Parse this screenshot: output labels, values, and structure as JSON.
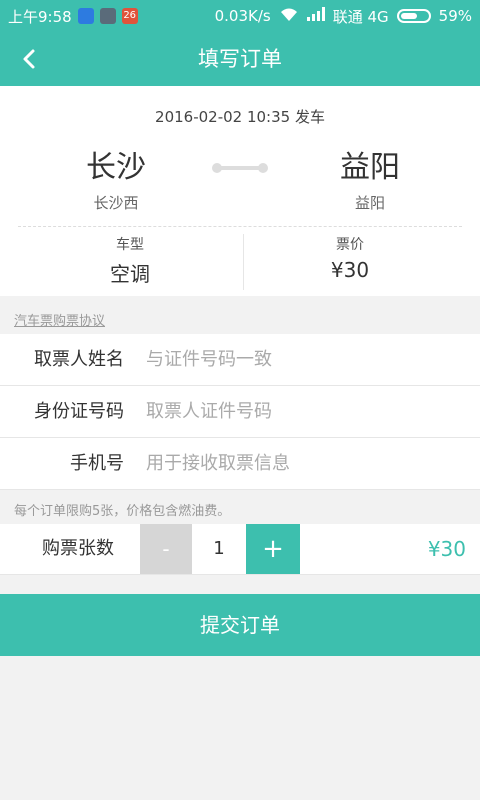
{
  "statusbar": {
    "time": "上午9:58",
    "badge": "26",
    "speed": "0.03K/s",
    "carrier": "联通 4G",
    "battery": "59%"
  },
  "header": {
    "title": "填写订单"
  },
  "trip": {
    "departure": "2016-02-02 10:35 发车",
    "from_city": "长沙",
    "from_station": "长沙西",
    "to_city": "益阳",
    "to_station": "益阳",
    "vehicle_label": "车型",
    "vehicle_value": "空调",
    "price_label": "票价",
    "price_value": "¥30"
  },
  "agreement": "汽车票购票协议",
  "form": {
    "name_label": "取票人姓名",
    "name_placeholder": "与证件号码一致",
    "id_label": "身份证号码",
    "id_placeholder": "取票人证件号码",
    "phone_label": "手机号",
    "phone_placeholder": "用于接收取票信息"
  },
  "limit_note": "每个订单限购5张，价格包含燃油费。",
  "quantity": {
    "label": "购票张数",
    "minus": "-",
    "count": "1",
    "plus": "+",
    "total": "¥30"
  },
  "submit": "提交订单",
  "colors": {
    "accent": "#3dbfae",
    "disabled": "#d6d6d6"
  }
}
